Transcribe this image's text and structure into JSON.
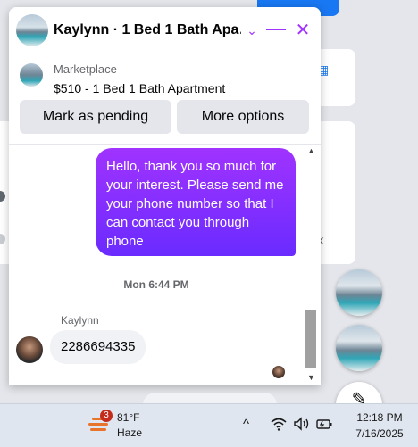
{
  "chat": {
    "title": "Kaylynn · 1 Bed 1 Bath Apa…",
    "chevron_icon": "chevron-down-icon",
    "minimize_icon": "minimize-icon",
    "close_icon": "close-icon",
    "accent_color": "#a033ff",
    "listing": {
      "source": "Marketplace",
      "title": "$510 - 1 Bed 1 Bath Apartment",
      "mark_pending_label": "Mark as pending",
      "more_options_label": "More options"
    },
    "messages": {
      "outgoing": "Hello, thank you so much for your interest. Please send me your phone number so that I can contact you through phone",
      "timestamp": "Mon 6:44 PM",
      "sender_name": "Kaylynn",
      "incoming": "2286694335"
    }
  },
  "taskbar": {
    "weather_badge": "3",
    "weather_temp": "81°F",
    "weather_desc": "Haze",
    "tray_chevron": "^",
    "wifi_icon": "wifi-icon",
    "volume_icon": "volume-icon",
    "battery_icon": "battery-icon",
    "time": "12:18 PM",
    "date": "7/16/2025"
  }
}
